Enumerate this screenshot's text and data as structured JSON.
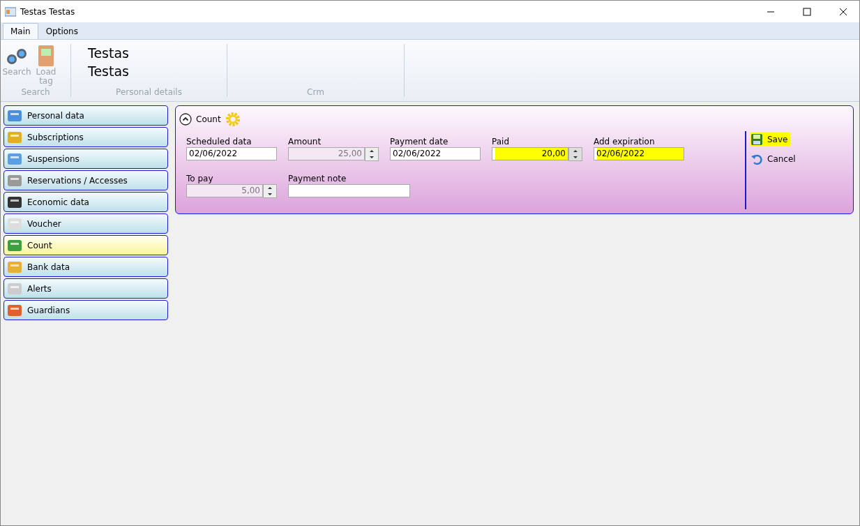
{
  "window": {
    "title": "Testas Testas"
  },
  "tabs": [
    {
      "label": "Main",
      "selected": true
    },
    {
      "label": "Options",
      "selected": false
    }
  ],
  "ribbon": {
    "groups": [
      {
        "kind": "buttons",
        "label": "Search",
        "buttons": [
          {
            "label": "Search",
            "disabled": true
          },
          {
            "label": "Load tag",
            "disabled": true
          }
        ]
      },
      {
        "kind": "text",
        "label": "Personal details",
        "lines": [
          "Testas",
          "Testas"
        ]
      },
      {
        "kind": "empty",
        "label": "Crm"
      }
    ]
  },
  "sidebar": {
    "items": [
      {
        "label": "Personal data",
        "selected": false
      },
      {
        "label": "Subscriptions",
        "selected": false
      },
      {
        "label": "Suspensions",
        "selected": false
      },
      {
        "label": "Reservations / Accesses",
        "selected": false
      },
      {
        "label": "Economic data",
        "selected": false
      },
      {
        "label": "Voucher",
        "selected": false
      },
      {
        "label": "Count",
        "selected": true
      },
      {
        "label": "Bank data",
        "selected": false
      },
      {
        "label": "Alerts",
        "selected": false
      },
      {
        "label": "Guardians",
        "selected": false
      }
    ]
  },
  "panel": {
    "title": "Count",
    "expanded": true,
    "rows": [
      [
        {
          "label": "Scheduled data",
          "kind": "text",
          "value": "02/06/2022",
          "disabled": false,
          "highlighted": false
        },
        {
          "label": "Amount",
          "kind": "spin",
          "value": "25,00",
          "disabled": true,
          "highlighted": false
        },
        {
          "label": "Payment date",
          "kind": "text",
          "value": "02/06/2022",
          "disabled": false,
          "highlighted": false
        },
        {
          "label": "Paid",
          "kind": "spin",
          "value": "20,00",
          "disabled": false,
          "highlighted": true
        },
        {
          "label": "Add expiration",
          "kind": "text",
          "value": "02/06/2022",
          "disabled": false,
          "highlighted": true
        }
      ],
      [
        {
          "label": "To pay",
          "kind": "spin",
          "value": "5,00",
          "disabled": true,
          "highlighted": false
        },
        {
          "label": "Payment note",
          "kind": "wide",
          "disabled": false,
          "highlighted": false
        }
      ]
    ],
    "actions": [
      {
        "label": "Save",
        "highlighted": true
      },
      {
        "label": "Cancel",
        "highlighted": false
      }
    ]
  }
}
